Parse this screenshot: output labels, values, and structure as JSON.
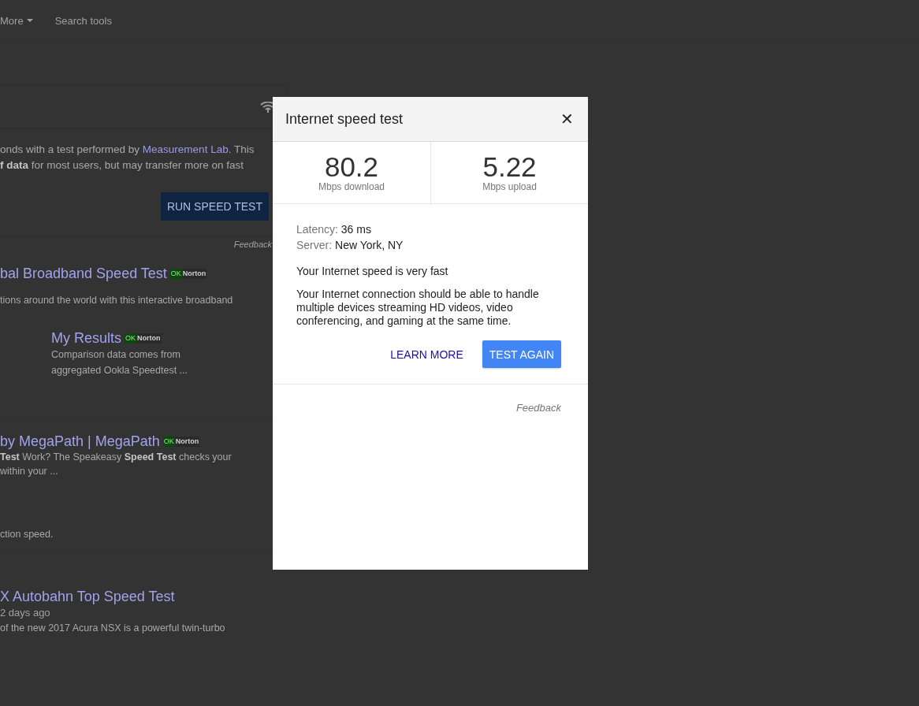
{
  "nav": {
    "items": [
      {
        "label": "More",
        "kind": "dropdown"
      },
      {
        "label": "Search tools",
        "kind": "plain"
      }
    ]
  },
  "speed_card": {
    "intro_before": "onds with a test performed by ",
    "intro_link": "Measurement Lab",
    "intro_after": ". This",
    "intro_line_2": "**f data** for most users, but may transfer more on fast",
    "button": "RUN SPEED TEST",
    "feedback": "Feedback"
  },
  "results": [
    {
      "title": "bal Broadband Speed Test",
      "badge": {
        "ok": "OK",
        "brand": "Norton"
      },
      "snippet_lines": [
        "tions around the world with this interactive broadband"
      ],
      "sitelink": {
        "title": "My Results",
        "badge": {
          "ok": "OK",
          "brand": "Norton"
        },
        "lines": [
          "Comparison data comes from",
          "aggregated Ookla Speedtest ..."
        ]
      }
    },
    {
      "title": "by MegaPath | MegaPath",
      "badge": {
        "ok": "OK",
        "brand": "Norton"
      },
      "snippet_lines": [
        "**Test** Work? The Speakeasy **Speed Test** checks your",
        "within your ..."
      ],
      "extra": "ction speed."
    },
    {
      "title": "X Autobahn Top Speed Test",
      "date": "2 days ago",
      "snippet_lines": [
        "of the new 2017 Acura NSX is a powerful twin-turbo"
      ]
    }
  ],
  "dialog": {
    "title": "Internet speed test",
    "close": "✕",
    "stats": [
      {
        "value": "80.2",
        "unit": "Mbps download"
      },
      {
        "value": "5.22",
        "unit": "Mbps upload"
      }
    ],
    "details": [
      {
        "label": "Latency:",
        "value": "36 ms"
      },
      {
        "label": "Server:",
        "value": "New York, NY"
      }
    ],
    "verdict": "Your Internet speed is very fast",
    "description": "Your Internet connection should be able to handle multiple devices streaming HD videos, video conferencing, and gaming at the same time.",
    "learn_more": "LEARN MORE",
    "test_again": "TEST AGAIN",
    "feedback": "Feedback"
  }
}
